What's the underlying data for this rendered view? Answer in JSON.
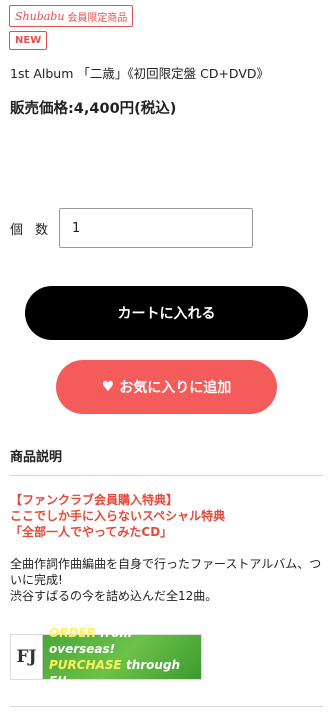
{
  "badges": {
    "member_brand": "Shubabu",
    "member_label": "会員限定商品",
    "new_label": "NEW"
  },
  "product": {
    "title": "1st Album 「二歳」《初回限定盤 CD+DVD》",
    "price": "販売価格:4,400円(税込)"
  },
  "quantity": {
    "label": "個数",
    "value": "1"
  },
  "actions": {
    "cart_label": "カートに入れる",
    "favorite_label": "お気に入りに追加",
    "favorite_icon": "heart-icon"
  },
  "description": {
    "heading": "商品説明",
    "highlight_lines": [
      "【ファンクラブ会員購入特典】",
      "ここでしか手に入らないスペシャル特典",
      "「全部一人でやってみたCD」"
    ],
    "body_lines": [
      "全曲作詞作曲編曲を自身で行ったファーストアルバム、ついに完成!",
      "渋谷すばるの今を詰め込んだ全12曲。"
    ]
  },
  "banner": {
    "logo_text": "FJ",
    "line1_a": "ORDER",
    "line1_b": "from overseas!",
    "line2_a": "PURCHASE",
    "line2_b": "through FJ!"
  },
  "colors": {
    "accent_red": "#e35050",
    "favorite_button": "#f45c5c",
    "cart_button": "#000000",
    "highlight_text": "#e24b3b"
  }
}
